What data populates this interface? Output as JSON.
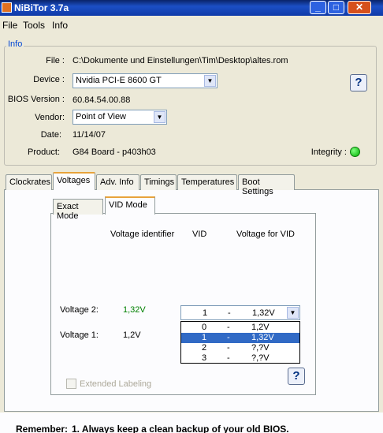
{
  "window": {
    "title": "NiBiTor 3.7a"
  },
  "menu": {
    "file": "File",
    "tools": "Tools",
    "info": "Info"
  },
  "info": {
    "group_label": "Info",
    "file_label": "File :",
    "file_value": "C:\\Dokumente und Einstellungen\\Tim\\Desktop\\altes.rom",
    "device_label": "Device :",
    "device_value": "Nvidia PCI-E 8600 GT",
    "bios_label": "BIOS Version :",
    "bios_value": "60.84.54.00.88",
    "vendor_label": "Vendor:",
    "vendor_value": "Point of View",
    "date_label": "Date:",
    "date_value": "11/14/07",
    "product_label": "Product:",
    "product_value": "G84 Board - p403h03",
    "integrity_label": "Integrity :",
    "help": "?"
  },
  "tabs": [
    "Clockrates",
    "Voltages",
    "Adv. Info",
    "Timings",
    "Temperatures",
    "Boot Settings"
  ],
  "subtabs": [
    "Exact Mode",
    "VID Mode"
  ],
  "vid": {
    "col_identifier": "Voltage identifier",
    "col_vid": "VID",
    "col_voltage": "Voltage for VID",
    "voltage2_label": "Voltage 2:",
    "voltage2_value": "1,32V",
    "voltage1_label": "Voltage 1:",
    "voltage1_value": "1,2V",
    "combo": {
      "vid": "1",
      "sep": "-",
      "voltage": "1,32V"
    },
    "options": [
      {
        "vid": "0",
        "sep": "-",
        "voltage": "1,2V"
      },
      {
        "vid": "1",
        "sep": "-",
        "voltage": "1,32V"
      },
      {
        "vid": "2",
        "sep": "-",
        "voltage": "?,?V"
      },
      {
        "vid": "3",
        "sep": "-",
        "voltage": "?,?V"
      }
    ],
    "extended_labeling": "Extended Labeling",
    "help": "?"
  },
  "footer": {
    "remember": "Remember:",
    "tip": "1. Always keep a clean backup of your old BIOS."
  },
  "colors": {
    "accent": "#316ac5",
    "voltage_green": "#008000",
    "integrity_ok": "#00c000"
  }
}
